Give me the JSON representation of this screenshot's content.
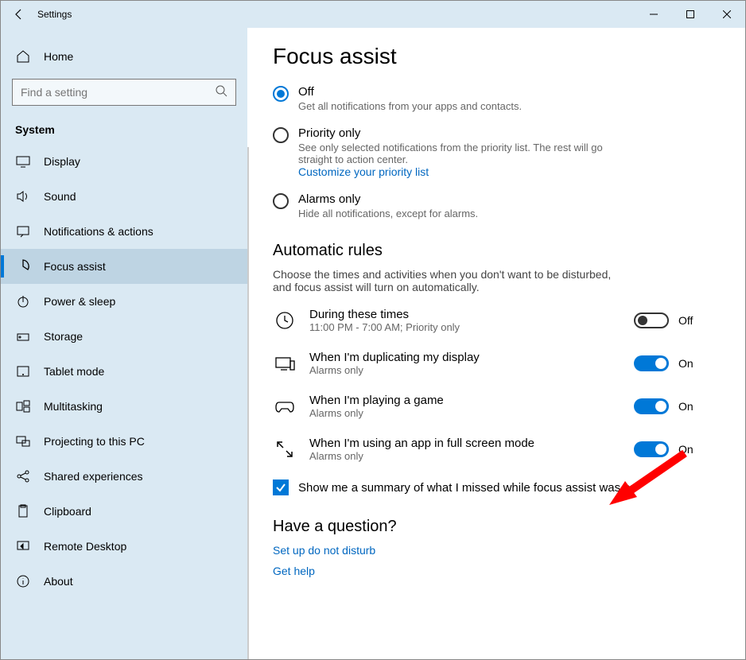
{
  "titlebar": {
    "title": "Settings"
  },
  "sidebar": {
    "home": "Home",
    "search_placeholder": "Find a setting",
    "section": "System",
    "items": [
      {
        "label": "Display"
      },
      {
        "label": "Sound"
      },
      {
        "label": "Notifications & actions"
      },
      {
        "label": "Focus assist",
        "selected": true
      },
      {
        "label": "Power & sleep"
      },
      {
        "label": "Storage"
      },
      {
        "label": "Tablet mode"
      },
      {
        "label": "Multitasking"
      },
      {
        "label": "Projecting to this PC"
      },
      {
        "label": "Shared experiences"
      },
      {
        "label": "Clipboard"
      },
      {
        "label": "Remote Desktop"
      },
      {
        "label": "About"
      }
    ]
  },
  "main": {
    "heading": "Focus assist",
    "radios": [
      {
        "title": "Off",
        "desc": "Get all notifications from your apps and contacts.",
        "selected": true
      },
      {
        "title": "Priority only",
        "desc": "See only selected notifications from the priority list. The rest will go straight to action center.",
        "link": "Customize your priority list"
      },
      {
        "title": "Alarms only",
        "desc": "Hide all notifications, except for alarms."
      }
    ],
    "rules_heading": "Automatic rules",
    "rules_desc": "Choose the times and activities when you don't want to be disturbed, and focus assist will turn on automatically.",
    "rules": [
      {
        "title": "During these times",
        "desc": "11:00 PM - 7:00 AM; Priority only",
        "state": "Off",
        "on": false
      },
      {
        "title": "When I'm duplicating my display",
        "desc": "Alarms only",
        "state": "On",
        "on": true
      },
      {
        "title": "When I'm playing a game",
        "desc": "Alarms only",
        "state": "On",
        "on": true
      },
      {
        "title": "When I'm using an app in full screen mode",
        "desc": "Alarms only",
        "state": "On",
        "on": true
      }
    ],
    "summary_checkbox": "Show me a summary of what I missed while focus assist was on",
    "question_heading": "Have a question?",
    "help_links": [
      "Set up do not disturb",
      "Get help"
    ]
  }
}
